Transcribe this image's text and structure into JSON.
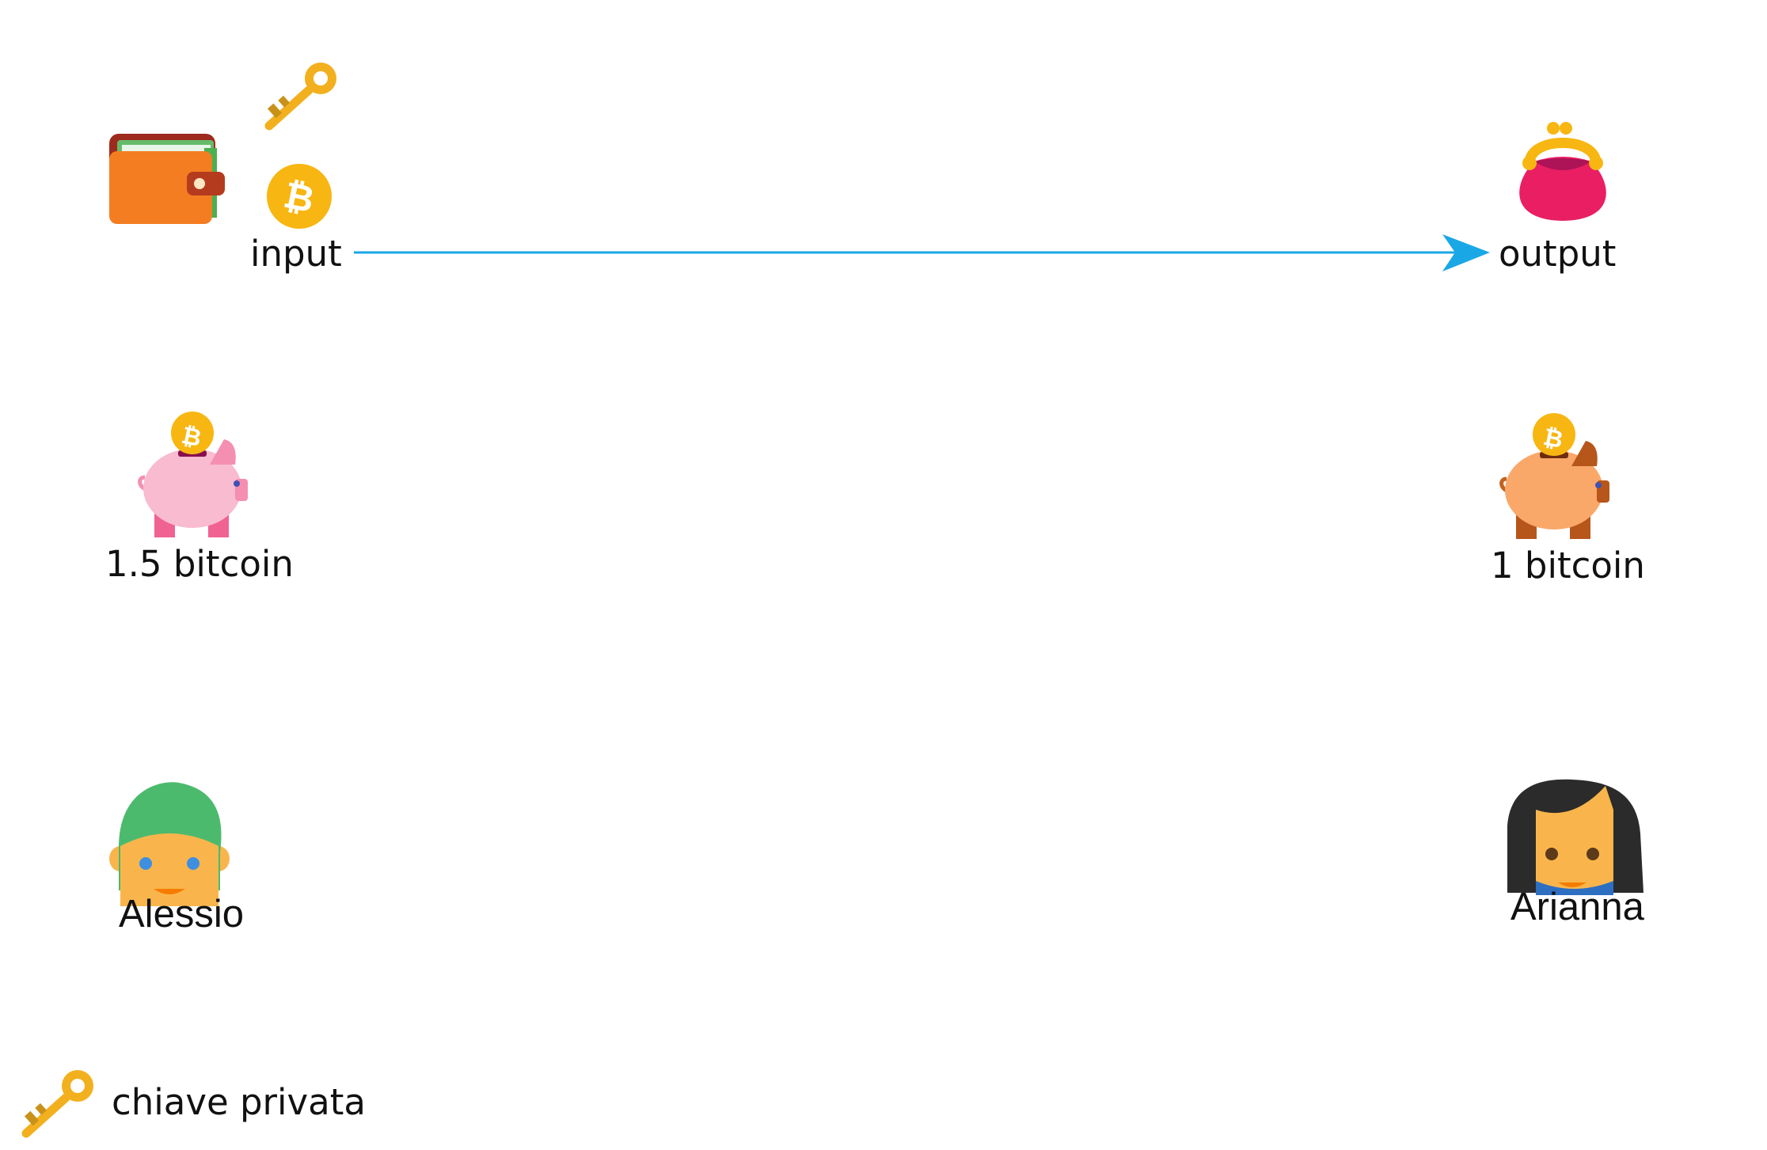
{
  "diagram": {
    "input_label": "input",
    "output_label": "output",
    "input_amount": "1.5 bitcoin",
    "output_amount": "1 bitcoin",
    "sender": "Alessio",
    "recipient": "Arianna",
    "legend_key": "chiave privata"
  },
  "icons": {
    "wallet": "wallet-icon",
    "key": "key-icon",
    "coin": "bitcoin-coin-icon",
    "purse": "purse-icon",
    "piggy_input": "piggy-bank-icon",
    "piggy_output": "piggy-bank-icon",
    "sender_avatar": "man-avatar-icon",
    "recipient_avatar": "woman-avatar-icon",
    "legend_key": "key-icon"
  },
  "colors": {
    "arrow": "#1aa7e6",
    "coin": "#f7b611",
    "key": "#f2b01e",
    "wallet": "#f47d21",
    "purse": "#e91e63",
    "piggy_input": "#f8bbd0",
    "piggy_output": "#f9a86a",
    "skin": "#f9b54c",
    "hair_man": "#4cba6c",
    "hair_woman": "#2b2b2b"
  }
}
